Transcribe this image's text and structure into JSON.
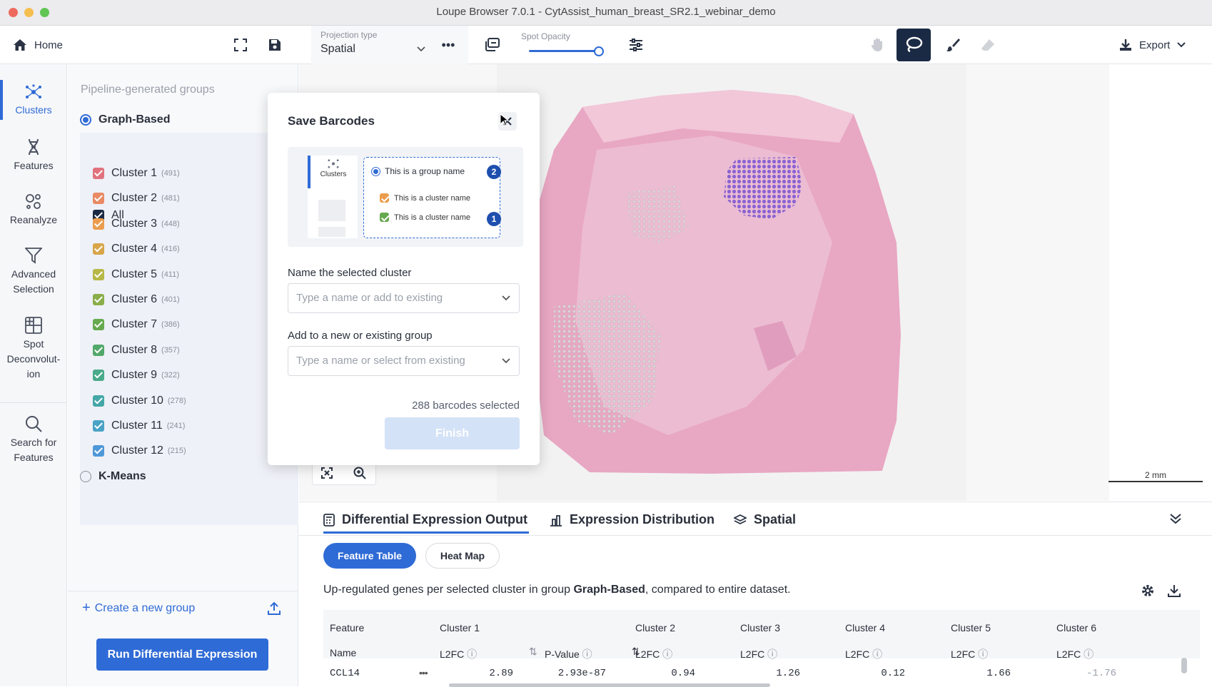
{
  "window": {
    "title": "Loupe Browser 7.0.1 - CytAssist_human_breast_SR2.1_webinar_demo"
  },
  "toolbar": {
    "home_label": "Home",
    "projection_label": "Projection type",
    "projection_value": "Spatial",
    "opacity_label": "Spot Opacity",
    "opacity_value": 1.0,
    "export_label": "Export"
  },
  "nav": {
    "clusters": "Clusters",
    "features": "Features",
    "reanalyze": "Reanalyze",
    "advanced_1": "Advanced",
    "advanced_2": "Selection",
    "spot_1": "Spot",
    "spot_2": "Deconvolut-",
    "spot_3": "ion",
    "search_1": "Search for",
    "search_2": "Features"
  },
  "panel": {
    "section_title": "Pipeline-generated groups",
    "group_graph": "Graph-Based",
    "all_label": "All",
    "clusters": [
      {
        "name": "Cluster 1",
        "count": "(491)",
        "color": "#e0727e"
      },
      {
        "name": "Cluster 2",
        "count": "(481)",
        "color": "#e98a64"
      },
      {
        "name": "Cluster 3",
        "count": "(448)",
        "color": "#eb9d4d"
      },
      {
        "name": "Cluster 4",
        "count": "(416)",
        "color": "#d8a64a"
      },
      {
        "name": "Cluster 5",
        "count": "(411)",
        "color": "#b7b848"
      },
      {
        "name": "Cluster 6",
        "count": "(401)",
        "color": "#8aae4a"
      },
      {
        "name": "Cluster 7",
        "count": "(386)",
        "color": "#67a94f"
      },
      {
        "name": "Cluster 8",
        "count": "(357)",
        "color": "#52a86a"
      },
      {
        "name": "Cluster 9",
        "count": "(322)",
        "color": "#4aaa8a"
      },
      {
        "name": "Cluster 10",
        "count": "(278)",
        "color": "#45a7a8"
      },
      {
        "name": "Cluster 11",
        "count": "(241)",
        "color": "#4aa2c6"
      },
      {
        "name": "Cluster 12",
        "count": "(215)",
        "color": "#4f98d8"
      }
    ],
    "group_kmeans": "K-Means",
    "create_group": "Create a new group",
    "run_de": "Run Differential Expression"
  },
  "modal": {
    "title": "Save Barcodes",
    "illus_clusters": "Clusters",
    "illus_group": "This is a group name",
    "illus_cluster1": "This is a cluster name",
    "illus_cluster2": "This is a cluster name",
    "badge_group": "2",
    "badge_cluster": "1",
    "name_label": "Name the selected cluster",
    "name_placeholder": "Type a name or add to existing",
    "group_label": "Add to a new or existing group",
    "group_placeholder": "Type a name or select from existing",
    "selected_count": "288 barcodes selected",
    "finish": "Finish"
  },
  "scale_bar": "2 mm",
  "bottom": {
    "tab_de": "Differential Expression Output",
    "tab_dist": "Expression Distribution",
    "tab_spatial": "Spatial",
    "btn_feature_table": "Feature Table",
    "btn_heat_map": "Heat Map",
    "desc_pre": "Up-regulated genes per selected cluster in group ",
    "desc_group": "Graph-Based",
    "desc_post": ", compared to entire dataset.",
    "table": {
      "col_feature": "Feature",
      "col_name": "Name",
      "clusters": [
        "Cluster 1",
        "Cluster 2",
        "Cluster 3",
        "Cluster 4",
        "Cluster 5",
        "Cluster 6"
      ],
      "l2fc": "L2FC",
      "pvalue": "P-Value",
      "row": {
        "name": "CCL14",
        "c1_l2fc": "2.89",
        "c1_p": "2.93e-87",
        "c2": "0.94",
        "c3": "1.26",
        "c4": "0.12",
        "c5": "1.66",
        "c6": "-1.76"
      }
    }
  },
  "colors": {
    "accent": "#2f6bd6",
    "lasso_active": "#1b2a44",
    "selection": "#8a63d2"
  }
}
